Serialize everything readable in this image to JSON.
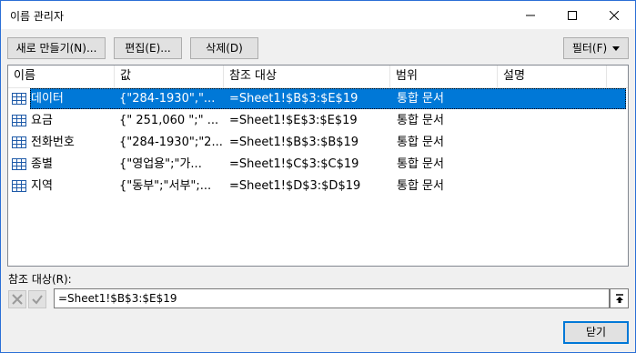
{
  "window": {
    "title": "이름 관리자"
  },
  "toolbar": {
    "new_label": "새로 만들기(N)...",
    "edit_label": "편집(E)...",
    "delete_label": "삭제(D)",
    "filter_label": "필터(F)"
  },
  "table": {
    "headers": [
      "이름",
      "값",
      "참조 대상",
      "범위",
      "설명"
    ],
    "rows": [
      {
        "name": "데이터",
        "value": "{\"284-1930\",\"...",
        "ref": "=Sheet1!$B$3:$E$19",
        "scope": "통합 문서",
        "comment": "",
        "selected": true
      },
      {
        "name": "요금",
        "value": "{\" 251,060 \";\" ...",
        "ref": "=Sheet1!$E$3:$E$19",
        "scope": "통합 문서",
        "comment": ""
      },
      {
        "name": "전화번호",
        "value": "{\"284-1930\";\"2...",
        "ref": "=Sheet1!$B$3:$B$19",
        "scope": "통합 문서",
        "comment": ""
      },
      {
        "name": "종별",
        "value": "{\"영업용\";\"가...",
        "ref": "=Sheet1!$C$3:$C$19",
        "scope": "통합 문서",
        "comment": ""
      },
      {
        "name": "지역",
        "value": "{\"동부\";\"서부\";...",
        "ref": "=Sheet1!$D$3:$D$19",
        "scope": "통합 문서",
        "comment": ""
      }
    ]
  },
  "refers_to": {
    "label": "참조 대상(R):",
    "value": "=Sheet1!$B$3:$E$19"
  },
  "footer": {
    "close_label": "닫기"
  },
  "colors": {
    "selection": "#0078d7",
    "border": "#2b6fd6"
  }
}
